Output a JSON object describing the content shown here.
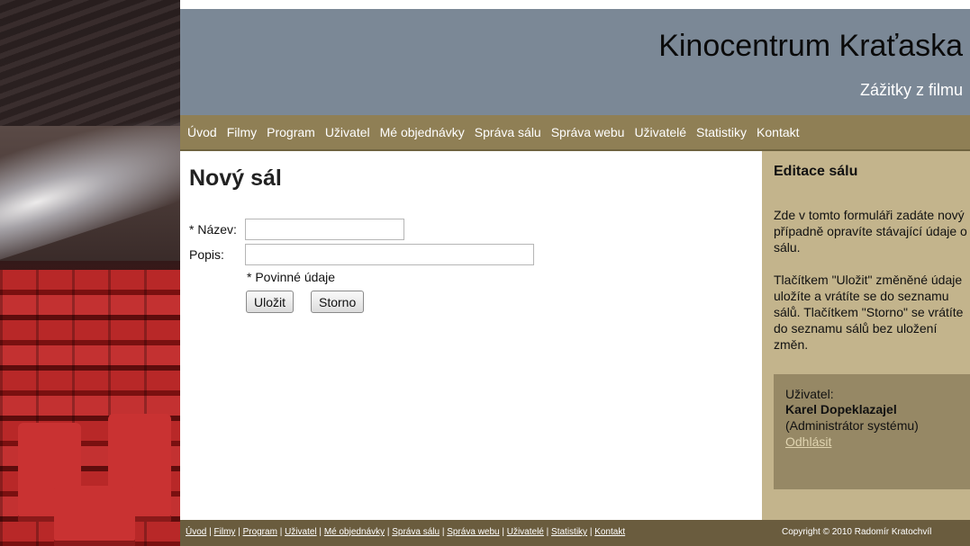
{
  "header": {
    "title": "Kinocentrum Kraťaska",
    "subtitle": "Zážitky z filmu"
  },
  "nav": {
    "items": [
      "Úvod",
      "Filmy",
      "Program",
      "Uživatel",
      "Mé objednávky",
      "Správa sálu",
      "Správa webu",
      "Uživatelé",
      "Statistiky",
      "Kontakt"
    ]
  },
  "main": {
    "title": "Nový sál",
    "fields": {
      "name_label": "* Název:",
      "name_value": "",
      "description_label": "Popis:",
      "description_value": ""
    },
    "required_note": "* Povinné údaje",
    "save_label": "Uložit",
    "cancel_label": "Storno"
  },
  "sidebar": {
    "title": "Editace sálu",
    "paragraph1": "Zde v tomto formuláři zadáte nový případně opravíte stávající údaje o sálu.",
    "paragraph2": "Tlačítkem \"Uložit\" změněné údaje uložíte a vrátíte se do seznamu sálů. Tlačítkem \"Storno\" se vrátíte do seznamu sálů bez uložení změn.",
    "user": {
      "label": "Uživatel:",
      "name": "Karel Dopeklazajel",
      "role": "(Administrátor systému)",
      "logout": "Odhlásit"
    }
  },
  "footer": {
    "links": [
      "Úvod",
      "Filmy",
      "Program",
      "Uživatel",
      "Mé objednávky",
      "Správa sálu",
      "Správa webu",
      "Uživatelé",
      "Statistiky",
      "Kontakt"
    ],
    "copyright": "Copyright © 2010 Radomír Kratochvíl"
  }
}
